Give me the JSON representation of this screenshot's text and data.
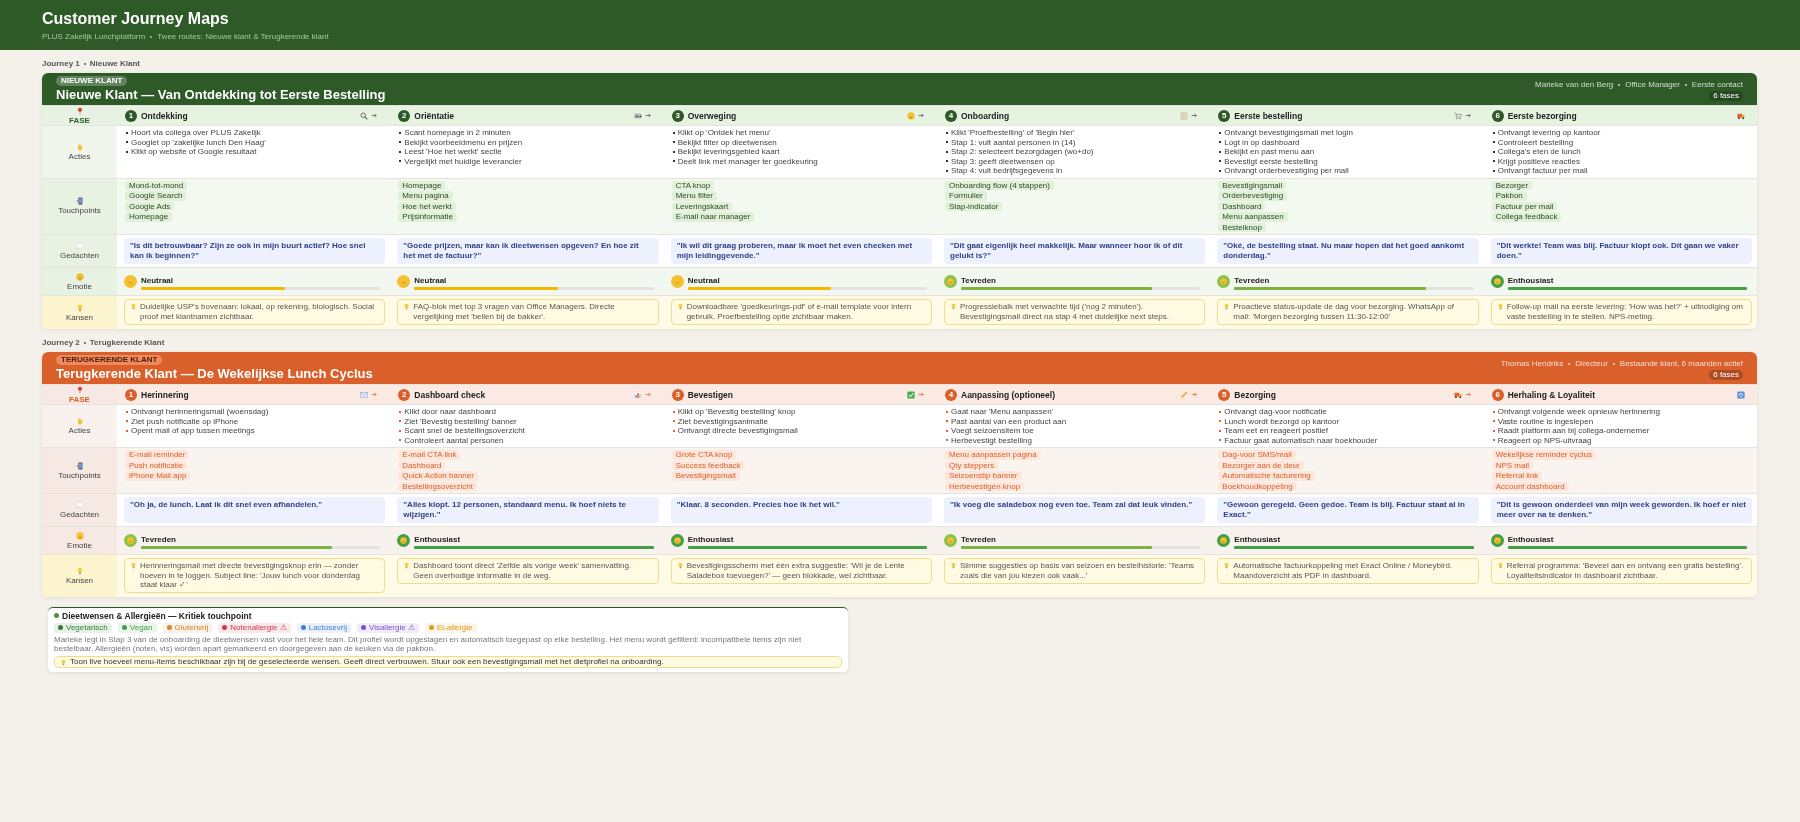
{
  "header": {
    "title": "Customer Journey Maps",
    "subtitle": [
      "PLUS Zakelijk Lunchplatform",
      "Twee routes: Nieuwe klant & Terugkerende klant"
    ]
  },
  "journeys": [
    {
      "kind": "new",
      "breadcrumb": [
        "Journey 1",
        "Nieuwe Klant"
      ],
      "badge": "NIEUWE KLANT",
      "title": "Nieuwe Klant — Van Ontdekking tot Eerste Bestelling",
      "persona": [
        "Marieke van den Berg",
        "Office Manager",
        "Eerste contact"
      ],
      "phase_count": "6 fases",
      "row_labels": [
        "FASE",
        "Acties",
        "Touchpoints",
        "Gedachten",
        "Emotie",
        "Kansen"
      ],
      "phases": [
        {
          "number": "1",
          "name": "Ontdekking",
          "actions": [
            "Hoort via collega over PLUS Zakelijk",
            "Googlet op 'zakelijke lunch Den Haag'",
            "Klikt op website of Google resultaat"
          ],
          "touchpoints": [
            "Mond-tot-mond",
            "Google Search",
            "Google Ads",
            "Homepage"
          ],
          "thought": "\"Is dit betrouwbaar? Zijn ze ook in mijn buurt actief? Hoe snel kan ik beginnen?\"",
          "emotion": {
            "kind": "neutral",
            "label": "Neutraal",
            "level": 0.6
          },
          "opportunity": "Duidelijke USP's bovenaan: lokaal, op rekening, biologisch. Social proof met klantnamen zichtbaar."
        },
        {
          "number": "2",
          "name": "Oriëntatie",
          "actions": [
            "Scant homepage in 2 minuten",
            "Bekijkt voorbeeldmenu en prijzen",
            "Leest 'Hoe het werkt' sectie",
            "Vergelijkt met huidige leverancier"
          ],
          "touchpoints": [
            "Homepage",
            "Menu pagina",
            "Hoe het werkt",
            "Prijsinformatie"
          ],
          "thought": "\"Goede prijzen, maar kan ik dieetwensen opgeven? En hoe zit het met de factuur?\"",
          "emotion": {
            "kind": "neutral",
            "label": "Neutraal",
            "level": 0.6
          },
          "opportunity": "FAQ-blok met top 3 vragen van Office Managers. Directe vergelijking met 'bellen bij de bakker'."
        },
        {
          "number": "3",
          "name": "Overweging",
          "actions": [
            "Klikt op 'Ontdek het menu'",
            "Bekijkt filter op dieetwensen",
            "Bekijkt leveringsgebied kaart",
            "Deelt link met manager ter goedkeuring"
          ],
          "touchpoints": [
            "CTA knop",
            "Menu filter",
            "Leveringskaart",
            "E-mail naar manager"
          ],
          "thought": "\"Ik wil dit graag proberen, maar ik moet het even checken met mijn leidinggevende.\"",
          "emotion": {
            "kind": "neutral",
            "label": "Neutraal",
            "level": 0.6
          },
          "opportunity": "Downloadbare 'goedkeurings-pdf' of e-mail template voor intern gebruik. Proefbestelling optie zichtbaar maken."
        },
        {
          "number": "4",
          "name": "Onboarding",
          "actions": [
            "Klikt 'Proefbestelling' of 'Begin hier'",
            "Stap 1: vult aantal personen in (14)",
            "Stap 2: selecteert bezorgdagen (wo+do)",
            "Stap 3: geeft dieetwensen op",
            "Stap 4: vult bedrijfsgegevens in"
          ],
          "touchpoints": [
            "Onboarding flow (4 stappen)",
            "Formulier",
            "Stap-indicator"
          ],
          "thought": "\"Dit gaat eigenlijk heel makkelijk. Maar wanneer hoor ik of dit gelukt is?\"",
          "emotion": {
            "kind": "satisfied",
            "label": "Tevreden",
            "level": 0.8
          },
          "opportunity": "Progressiebalk met verwachte tijd ('nog 2 minuten'). Bevestigingsmail direct na stap 4 met duidelijke next steps."
        },
        {
          "number": "5",
          "name": "Eerste bestelling",
          "actions": [
            "Ontvangt bevestigingsmail met login",
            "Logt in op dashboard",
            "Bekijkt en past menu aan",
            "Bevestigt eerste bestelling",
            "Ontvangt orderbevestiging per mail"
          ],
          "touchpoints": [
            "Bevestigingsmail",
            "Orderbevestiging",
            "Dashboard",
            "Menu aanpassen",
            "Bestelknop"
          ],
          "thought": "\"Oké, de bestelling staat. Nu maar hopen dat het goed aankomt donderdag.\"",
          "emotion": {
            "kind": "satisfied",
            "label": "Tevreden",
            "level": 0.8
          },
          "opportunity": "Proactieve status-update de dag voor bezorging. WhatsApp of mail: 'Morgen bezorging tussen 11:30-12:00'"
        },
        {
          "number": "6",
          "name": "Eerste bezorging",
          "actions": [
            "Ontvangt levering op kantoor",
            "Controleert bestelling",
            "Collega's eten de lunch",
            "Krijgt positieve reacties",
            "Ontvangt factuur per mail"
          ],
          "touchpoints": [
            "Bezorger",
            "Pakbon",
            "Factuur per mail",
            "Collega feedback"
          ],
          "thought": "\"Dit werkte! Team was blij. Factuur klopt ook. Dit gaan we vaker doen.\"",
          "emotion": {
            "kind": "enthusiastic",
            "label": "Enthousiast",
            "level": 1
          },
          "opportunity": "Follow-up mail na eerste levering: 'How was het?' + uitnodiging om vaste bestelling in te stellen. NPS-meting."
        }
      ]
    },
    {
      "kind": "returning",
      "breadcrumb": [
        "Journey 2",
        "Terugkerende Klant"
      ],
      "badge": "TERUGKERENDE KLANT",
      "title": "Terugkerende Klant — De Wekelijkse Lunch Cyclus",
      "persona": [
        "Thomas Hendriks",
        "Directeur",
        "Bestaande klant, 6 maanden actief"
      ],
      "phase_count": "6 fases",
      "row_labels": [
        "FASE",
        "Acties",
        "Touchpoints",
        "Gedachten",
        "Emotie",
        "Kansen"
      ],
      "phases": [
        {
          "number": "1",
          "name": "Herinnering",
          "actions": [
            "Ontvangt herinneringsmail (woensdag)",
            "Ziet push notificatie op iPhone",
            "Opent mail of app tussen meetings"
          ],
          "touchpoints": [
            "E-mail reminder",
            "Push notificatie",
            "iPhone Mail app"
          ],
          "thought": "\"Oh ja, de lunch. Laat ik dit snel even afhandelen.\"",
          "emotion": {
            "kind": "satisfied",
            "label": "Tevreden",
            "level": 0.8
          },
          "opportunity": "Herinneringsmail met directe bevestigingsknop erin — zonder hoeven in te loggen. Subject line: 'Jouw lunch voor donderdag staat klaar ✓'"
        },
        {
          "number": "2",
          "name": "Dashboard check",
          "actions": [
            "Klikt door naar dashboard",
            "Ziet 'Bevestig bestelling' banner",
            "Scant snel de bestellingsoverzicht",
            "Controleert aantal personen"
          ],
          "touchpoints": [
            "E-mail CTA link",
            "Dashboard",
            "Quick Action banner",
            "Bestellingsoverzicht"
          ],
          "thought": "\"Alles klopt. 12 personen, standaard menu. Ik hoef niets te wijzigen.\"",
          "emotion": {
            "kind": "enthusiastic",
            "label": "Enthousiast",
            "level": 1
          },
          "opportunity": "Dashboard toont direct 'Zelfde als vorige week' samenvatting. Geen overbodige informatie in de weg."
        },
        {
          "number": "3",
          "name": "Bevestigen",
          "actions": [
            "Klikt op 'Bevestig bestelling' knop",
            "Ziet bevestigingsanimatie",
            "Ontvangt directe bevestigingsmail"
          ],
          "touchpoints": [
            "Grote CTA knop",
            "Success feedback",
            "Bevestigingsmail"
          ],
          "thought": "\"Klaar. 8 seconden. Precies hoe ik het wil.\"",
          "emotion": {
            "kind": "enthusiastic",
            "label": "Enthousiast",
            "level": 1
          },
          "opportunity": "Bevestigingsscherm met één extra suggestie: 'Wil je de Lente Saladebox toevoegen?' — geen blokkade, wel zichtbaar."
        },
        {
          "number": "4",
          "name": "Aanpassing (optioneel)",
          "actions": [
            "Gaat naar 'Menu aanpassen'",
            "Past aantal van een product aan",
            "Voegt seizoensitem toe",
            "Herbevestigt bestelling"
          ],
          "touchpoints": [
            "Menu aanpassen pagina",
            "Qty steppers",
            "Seizoenstip banner",
            "Herbevestigen knop"
          ],
          "thought": "\"Ik voeg die saladebox nog even toe. Team zal dat leuk vinden.\"",
          "emotion": {
            "kind": "satisfied",
            "label": "Tevreden",
            "level": 0.8
          },
          "opportunity": "Slimme suggesties op basis van seizoen en bestelhistorie: 'Teams zoals die van jou kiezen ook vaak...'"
        },
        {
          "number": "5",
          "name": "Bezorging",
          "actions": [
            "Ontvangt dag-voor notificatie",
            "Lunch wordt bezorgd op kantoor",
            "Team eet en reageert positief",
            "Factuur gaat automatisch naar boekhouder"
          ],
          "touchpoints": [
            "Dag-voor SMS/mail",
            "Bezorger aan de deur",
            "Automatische facturering",
            "Boekhoudkoppeling"
          ],
          "thought": "\"Gewoon geregeld. Geen gedoe. Team is blij. Factuur staat al in Exact.\"",
          "emotion": {
            "kind": "enthusiastic",
            "label": "Enthousiast",
            "level": 1
          },
          "opportunity": "Automatische factuurkoppeling met Exact Online / Moneybird. Maandoverzicht als PDF in dashboard."
        },
        {
          "number": "6",
          "name": "Herhaling & Loyaliteit",
          "actions": [
            "Ontvangt volgende week opnieuw herinnering",
            "Vaste routine is ingeslepen",
            "Raadt platform aan bij collega-ondernemer",
            "Reageert op NPS-uitvraag"
          ],
          "touchpoints": [
            "Wekelijkse reminder cyclus",
            "NPS mail",
            "Referral link",
            "Account dashboard"
          ],
          "thought": "\"Dit is gewoon onderdeel van mijn week geworden. Ik hoef er niet meer over na te denken.\"",
          "emotion": {
            "kind": "enthusiastic",
            "label": "Enthousiast",
            "level": 1
          },
          "opportunity": "Referral programma: 'Beveel aan en ontvang een gratis bestelling'. Loyaliteitsindicator in dashboard zichtbaar."
        }
      ]
    }
  ],
  "diet_panel": {
    "title": "Dieetwensen & Allergieën — Kritiek touchpoint",
    "tags": [
      {
        "label": "Vegetarisch",
        "color": "#2e7d32"
      },
      {
        "label": "Vegan",
        "color": "#43a047"
      },
      {
        "label": "Glutenvrij",
        "color": "#d9822b"
      },
      {
        "label": "Notenallergie ⚠",
        "color": "#d2384b"
      },
      {
        "label": "Lactosevrij",
        "color": "#3d7fd6"
      },
      {
        "label": "Visallergie ⚠",
        "color": "#7b4fd0"
      },
      {
        "label": "Ei-allergie",
        "color": "#e09a1a"
      }
    ],
    "description": "Marieke legt in Stap 3 van de onboarding de dieetwensen vast voor het hele team. Dit profiel wordt opgeslagen en automatisch toegepast op elke bestelling. Het menu wordt gefilterd: incompatibele items zijn niet bestelbaar. Allergieën (noten, vis) worden apart gemarkeerd en doorgegeven aan de keuken via de pakbon.",
    "tip": "Toon live hoeveel menu-items beschikbaar zijn bij de geselecteerde wensen. Geeft direct vertrouwen. Stuur ook een bevestigingsmail met het dietprofiel na onboarding."
  }
}
